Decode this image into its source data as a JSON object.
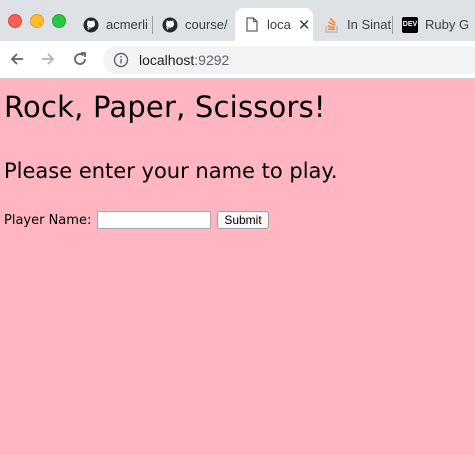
{
  "browser": {
    "tabs": [
      {
        "title": "acmerli",
        "icon": "github-icon"
      },
      {
        "title": "course/",
        "icon": "github-icon"
      },
      {
        "title": "loca",
        "icon": "page-icon",
        "active": true
      },
      {
        "title": "In Sinat",
        "icon": "stackoverflow-icon"
      },
      {
        "title": "Ruby G",
        "icon": "dev-icon",
        "icon_text": "DEV"
      }
    ],
    "close_glyph": "✕",
    "url": {
      "host": "localhost",
      "port": ":9292"
    }
  },
  "page": {
    "title": "Rock, Paper, Scissors!",
    "subtitle": "Please enter your name to play.",
    "form": {
      "label": "Player Name:",
      "input_value": "",
      "submit_label": "Submit"
    }
  },
  "colors": {
    "page_background": "#ffb6c1",
    "tabstrip": "#dee1e6"
  }
}
